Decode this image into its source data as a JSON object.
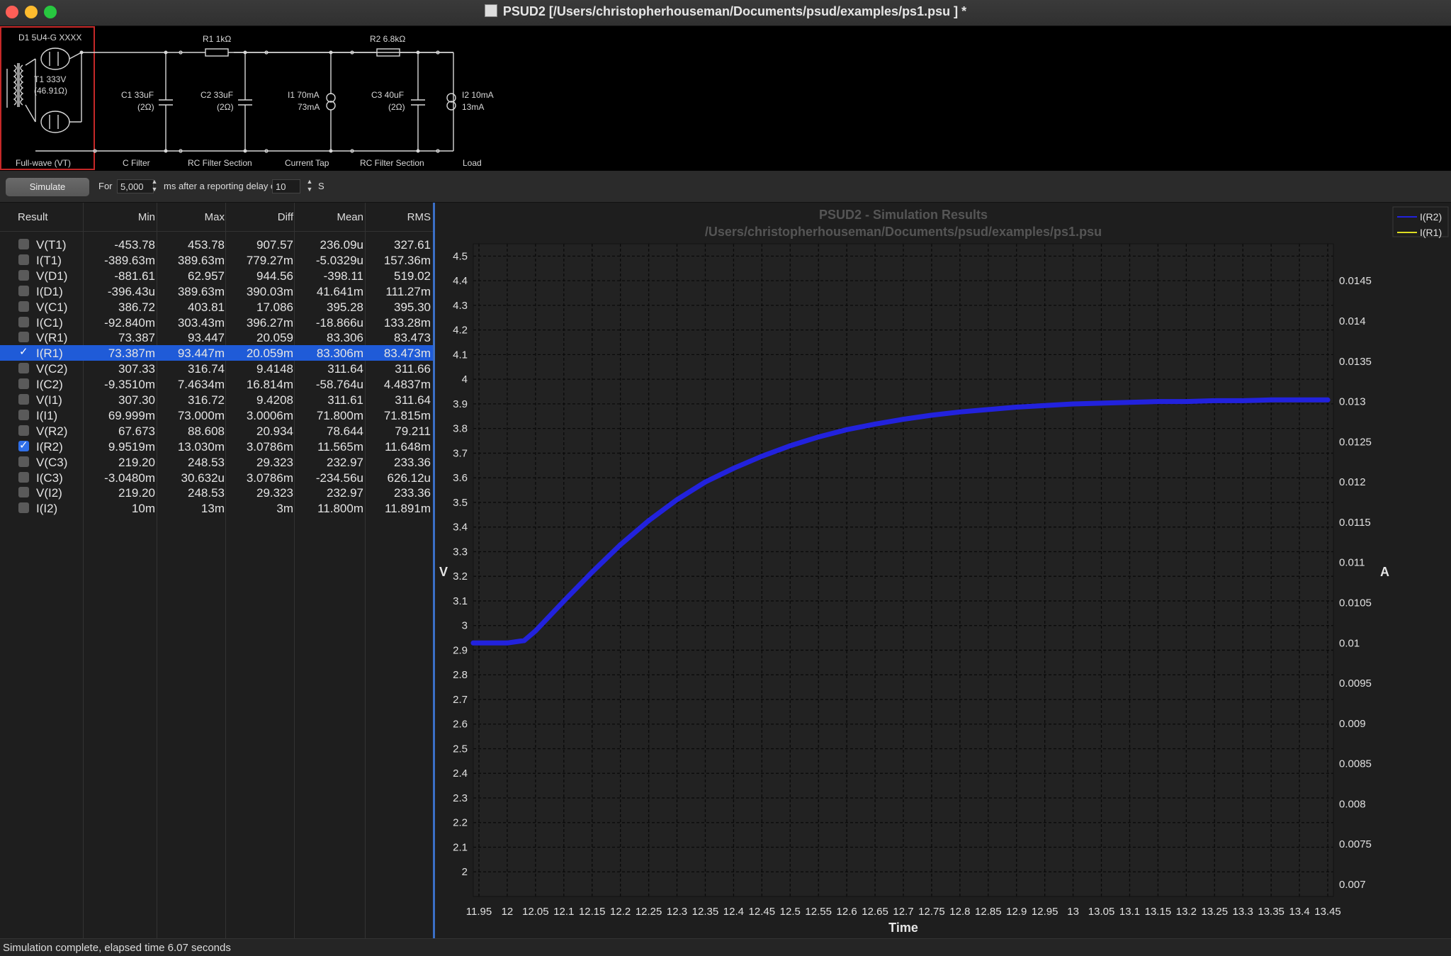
{
  "window": {
    "title": "PSUD2  [/Users/christopherhouseman/Documents/psud/examples/ps1.psu ] *"
  },
  "schematic": {
    "rectifier": {
      "label_top": "D1 5U4-G XXXX",
      "transformer_1": "T1 333V",
      "transformer_2": "(46.91Ω)",
      "section": "Full-wave (VT)"
    },
    "c1": {
      "l1": "C1 33uF",
      "l2": "(2Ω)",
      "section": "C Filter"
    },
    "r1": {
      "label": "R1 1kΩ",
      "c2_1": "C2 33uF",
      "c2_2": "(2Ω)",
      "section": "RC Filter Section"
    },
    "i1": {
      "l1": "I1 70mA",
      "l2": "73mA",
      "section": "Current Tap"
    },
    "r2": {
      "label": "R2 6.8kΩ",
      "c3_1": "C3 40uF",
      "c3_2": "(2Ω)",
      "section": "RC Filter Section"
    },
    "i2": {
      "l1": "I2 10mA",
      "l2": "13mA",
      "section": "Load"
    }
  },
  "toolbar": {
    "simulate_label": "Simulate",
    "for_label": "For",
    "duration_value": "5,000",
    "after_label": "ms after a reporting delay of",
    "delay_value": "10",
    "unit_label": "S"
  },
  "results": {
    "headers": [
      "Result",
      "Min",
      "Max",
      "Diff",
      "Mean",
      "RMS"
    ],
    "rows": [
      {
        "name": "V(T1)",
        "checked": false,
        "min": "-453.78",
        "max": "453.78",
        "diff": "907.57",
        "mean": "236.09u",
        "rms": "327.61"
      },
      {
        "name": "I(T1)",
        "checked": false,
        "min": "-389.63m",
        "max": "389.63m",
        "diff": "779.27m",
        "mean": "-5.0329u",
        "rms": "157.36m"
      },
      {
        "name": "V(D1)",
        "checked": false,
        "min": "-881.61",
        "max": "62.957",
        "diff": "944.56",
        "mean": "-398.11",
        "rms": "519.02"
      },
      {
        "name": "I(D1)",
        "checked": false,
        "min": "-396.43u",
        "max": "389.63m",
        "diff": "390.03m",
        "mean": "41.641m",
        "rms": "111.27m"
      },
      {
        "name": "V(C1)",
        "checked": false,
        "min": "386.72",
        "max": "403.81",
        "diff": "17.086",
        "mean": "395.28",
        "rms": "395.30"
      },
      {
        "name": "I(C1)",
        "checked": false,
        "min": "-92.840m",
        "max": "303.43m",
        "diff": "396.27m",
        "mean": "-18.866u",
        "rms": "133.28m"
      },
      {
        "name": "V(R1)",
        "checked": false,
        "min": "73.387",
        "max": "93.447",
        "diff": "20.059",
        "mean": "83.306",
        "rms": "83.473"
      },
      {
        "name": "I(R1)",
        "checked": true,
        "selected": true,
        "min": "73.387m",
        "max": "93.447m",
        "diff": "20.059m",
        "mean": "83.306m",
        "rms": "83.473m"
      },
      {
        "name": "V(C2)",
        "checked": false,
        "min": "307.33",
        "max": "316.74",
        "diff": "9.4148",
        "mean": "311.64",
        "rms": "311.66"
      },
      {
        "name": "I(C2)",
        "checked": false,
        "min": "-9.3510m",
        "max": "7.4634m",
        "diff": "16.814m",
        "mean": "-58.764u",
        "rms": "4.4837m"
      },
      {
        "name": "V(I1)",
        "checked": false,
        "min": "307.30",
        "max": "316.72",
        "diff": "9.4208",
        "mean": "311.61",
        "rms": "311.64"
      },
      {
        "name": "I(I1)",
        "checked": false,
        "min": "69.999m",
        "max": "73.000m",
        "diff": "3.0006m",
        "mean": "71.800m",
        "rms": "71.815m"
      },
      {
        "name": "V(R2)",
        "checked": false,
        "min": "67.673",
        "max": "88.608",
        "diff": "20.934",
        "mean": "78.644",
        "rms": "79.211"
      },
      {
        "name": "I(R2)",
        "checked": true,
        "min": "9.9519m",
        "max": "13.030m",
        "diff": "3.0786m",
        "mean": "11.565m",
        "rms": "11.648m"
      },
      {
        "name": "V(C3)",
        "checked": false,
        "min": "219.20",
        "max": "248.53",
        "diff": "29.323",
        "mean": "232.97",
        "rms": "233.36"
      },
      {
        "name": "I(C3)",
        "checked": false,
        "min": "-3.0480m",
        "max": "30.632u",
        "diff": "3.0786m",
        "mean": "-234.56u",
        "rms": "626.12u"
      },
      {
        "name": "V(I2)",
        "checked": false,
        "min": "219.20",
        "max": "248.53",
        "diff": "29.323",
        "mean": "232.97",
        "rms": "233.36"
      },
      {
        "name": "I(I2)",
        "checked": false,
        "min": "10m",
        "max": "13m",
        "diff": "3m",
        "mean": "11.800m",
        "rms": "11.891m"
      }
    ]
  },
  "chart_data": {
    "type": "line",
    "title": "PSUD2 - Simulation Results",
    "subtitle": "/Users/christopherhouseman/Documents/psud/examples/ps1.psu",
    "xlabel": "Time",
    "ylabel_left": "V",
    "ylabel_right": "A",
    "xlim": [
      11.94,
      13.46
    ],
    "ylim_left": [
      1.9,
      4.55
    ],
    "ylim_right": [
      0.00685,
      0.01496
    ],
    "x_ticks": [
      "11.95",
      "12",
      "12.05",
      "12.1",
      "12.15",
      "12.2",
      "12.25",
      "12.3",
      "12.35",
      "12.4",
      "12.45",
      "12.5",
      "12.55",
      "12.6",
      "12.65",
      "12.7",
      "12.75",
      "12.8",
      "12.85",
      "12.9",
      "12.95",
      "13",
      "13.05",
      "13.1",
      "13.15",
      "13.2",
      "13.25",
      "13.3",
      "13.35",
      "13.4",
      "13.45"
    ],
    "y_left_ticks": [
      "2",
      "2.1",
      "2.2",
      "2.3",
      "2.4",
      "2.5",
      "2.6",
      "2.7",
      "2.8",
      "2.9",
      "3",
      "3.1",
      "3.2",
      "3.3",
      "3.4",
      "3.5",
      "3.6",
      "3.7",
      "3.8",
      "3.9",
      "4",
      "4.1",
      "4.2",
      "4.3",
      "4.4",
      "4.5"
    ],
    "y_right_ticks": [
      "0.007",
      "0.0075",
      "0.008",
      "0.0085",
      "0.009",
      "0.0095",
      "0.01",
      "0.0105",
      "0.011",
      "0.0115",
      "0.012",
      "0.0125",
      "0.013",
      "0.0135",
      "0.014",
      "0.0145"
    ],
    "grid": true,
    "legend_position": "top-right",
    "series": [
      {
        "name": "I(R2)",
        "color": "#2222dd",
        "x": [
          11.94,
          12.0,
          12.03,
          12.05,
          12.1,
          12.15,
          12.2,
          12.25,
          12.3,
          12.35,
          12.4,
          12.45,
          12.5,
          12.55,
          12.6,
          12.65,
          12.7,
          12.75,
          12.8,
          12.85,
          12.9,
          12.95,
          13.0,
          13.05,
          13.1,
          13.15,
          13.2,
          13.25,
          13.3,
          13.35,
          13.4,
          13.45
        ],
        "y": [
          0.01,
          0.01,
          0.01003,
          0.01015,
          0.01052,
          0.01088,
          0.01122,
          0.01152,
          0.01178,
          0.012,
          0.01217,
          0.01232,
          0.01245,
          0.01256,
          0.01265,
          0.01272,
          0.01278,
          0.01283,
          0.01287,
          0.0129,
          0.01293,
          0.01295,
          0.01297,
          0.01298,
          0.01299,
          0.013,
          0.013,
          0.01301,
          0.01301,
          0.01302,
          0.01302,
          0.01302
        ]
      },
      {
        "name": "I(R1)",
        "color": "#dddd22",
        "x": [],
        "y": []
      }
    ]
  },
  "status": {
    "text": "Simulation complete, elapsed time 6.07 seconds"
  }
}
